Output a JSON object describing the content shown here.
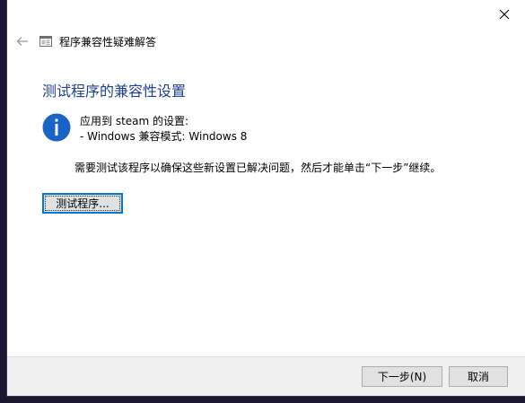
{
  "window": {
    "close_icon": "close-icon"
  },
  "nav": {
    "back_icon": "back-arrow-icon",
    "app_icon": "compatibility-troubleshooter-icon",
    "title": "程序兼容性疑难解答"
  },
  "main": {
    "heading": "测试程序的兼容性设置",
    "info_icon": "info-icon",
    "applied_to": "应用到 steam 的设置:",
    "mode_setting": "- Windows 兼容模式: Windows 8",
    "description": "需要测试该程序以确保这些新设置已解决问题，然后才能单击“下一步”继续。",
    "test_button_label": "测试程序..."
  },
  "footer": {
    "next_button_label": "下一步(N)",
    "cancel_button_label": "取消"
  },
  "colors": {
    "heading": "#1f3f8f",
    "info_icon": "#1a63c6",
    "focus_border": "#0078d7",
    "footer_bg": "#f0f0f0",
    "desktop_bg": "#1c1730"
  }
}
